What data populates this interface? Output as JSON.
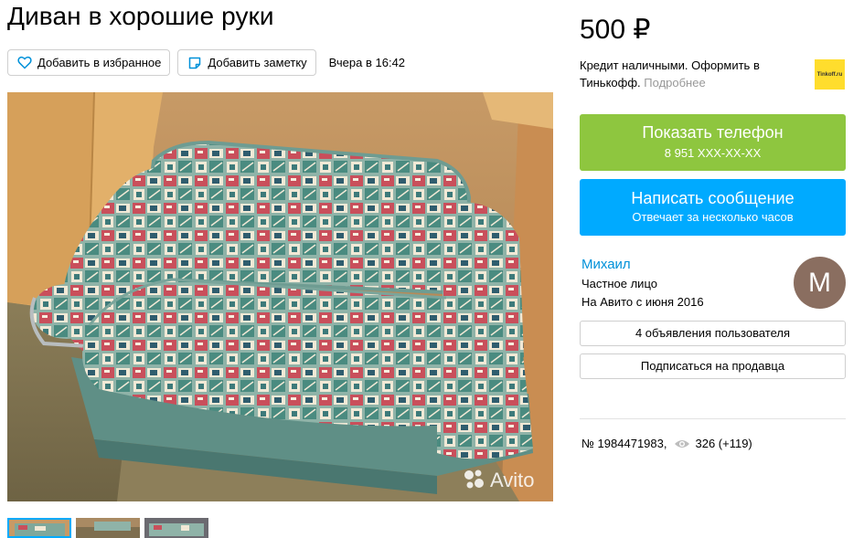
{
  "title": "Диван в хорошие руки",
  "actions": {
    "favorite_label": "Добавить в избранное",
    "note_label": "Добавить заметку",
    "date": "Вчера в 16:42"
  },
  "photo": {
    "watermark": "Avito",
    "thumbnails": 3,
    "active_thumbnail": 1
  },
  "price": "500 ₽",
  "credit": {
    "text": "Кредит наличными. Оформить в Тинькофф.",
    "more": "Подробнее",
    "logo_text": "Tinkoff.ru"
  },
  "phone": {
    "label": "Показать телефон",
    "number": "8 951 XXX-XX-XX"
  },
  "message": {
    "label": "Написать сообщение",
    "sub": "Отвечает за несколько часов"
  },
  "seller": {
    "name": "Михаил",
    "type": "Частное лицо",
    "since": "На Авито с июня 2016",
    "avatar_letter": "М"
  },
  "seller_ads_label": "4 объявления пользователя",
  "subscribe_label": "Подписаться на продавца",
  "meta": {
    "id": "№ 1984471983,",
    "views": "326 (+119)"
  },
  "colors": {
    "phone_button": "#8ec63f",
    "message_button": "#00aaff",
    "link": "#0091d9",
    "avatar": "#8a6e60",
    "tinkoff": "#ffdd2d"
  }
}
